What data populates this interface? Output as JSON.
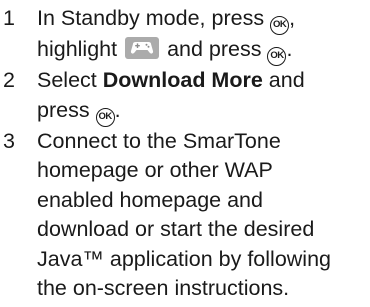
{
  "steps": [
    {
      "number": "1",
      "text_a": "In Standby mode, press",
      "text_b": ",",
      "text_c": "highlight",
      "text_d": "and press",
      "text_e": "."
    },
    {
      "number": "2",
      "text_a": "Select",
      "bold": "Download More",
      "text_b": "and",
      "text_c": "press",
      "text_d": "."
    },
    {
      "number": "3",
      "lines": [
        "Connect to the SmarTone",
        "homepage or other WAP",
        "enabled homepage and",
        "download or start the desired",
        "Java™ application by following",
        "the on-screen instructions."
      ]
    }
  ],
  "icons": {
    "ok_glyph": "OK",
    "ok_icon": "ok-key-icon",
    "menu_icon": "games-gamepad-icon",
    "menu_icon_color": "#a9a9a9"
  }
}
